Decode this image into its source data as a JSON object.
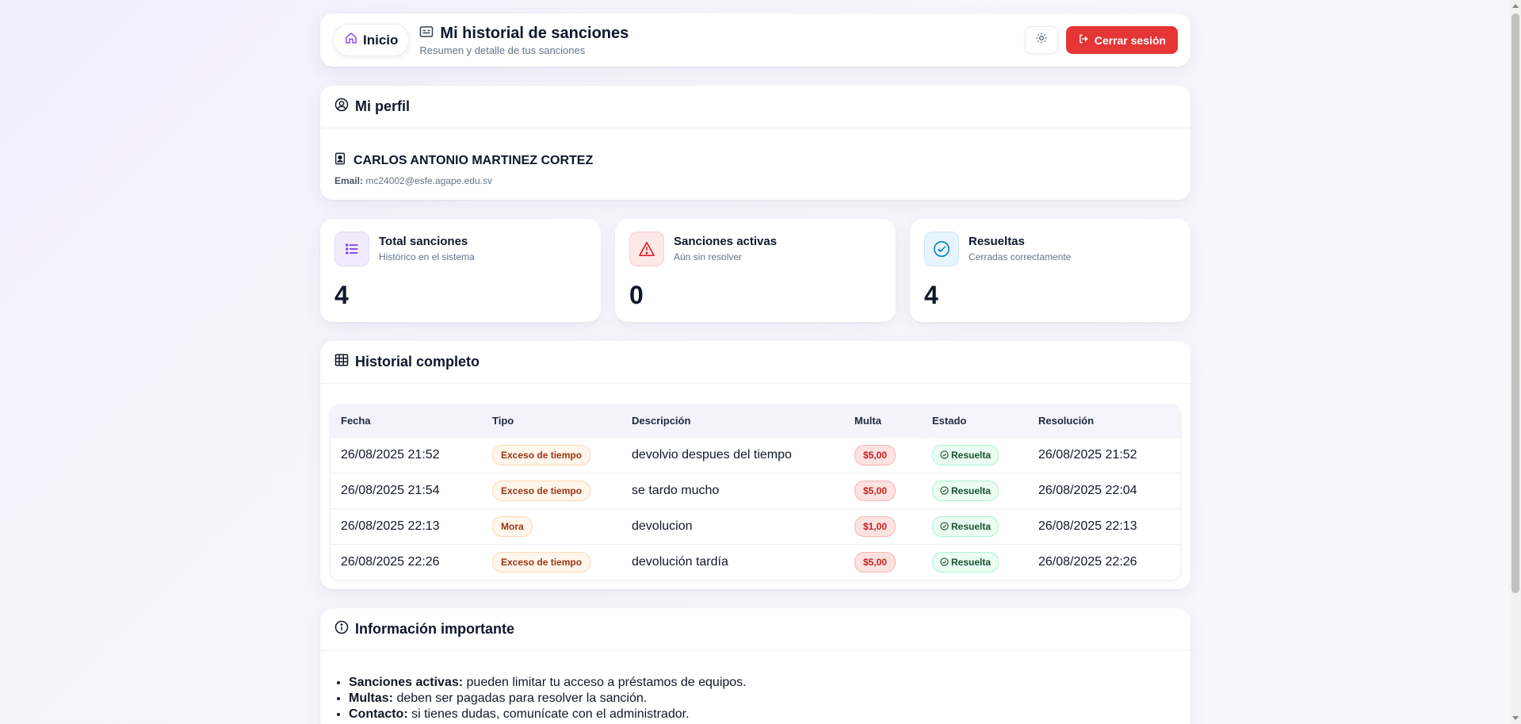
{
  "header": {
    "home_label": "Inicio",
    "title": "Mi historial de sanciones",
    "subtitle": "Resumen y detalle de tus sanciones",
    "logout_label": "Cerrar sesión"
  },
  "profile": {
    "section_title": "Mi perfil",
    "name": "CARLOS ANTONIO MARTINEZ CORTEZ",
    "email_label": "Email:",
    "email": "mc24002@esfe.agape.edu.sv"
  },
  "stats": [
    {
      "title": "Total sanciones",
      "subtitle": "Histórico en el sistema",
      "value": "4",
      "icon": "list-icon",
      "color": "#7c3aed"
    },
    {
      "title": "Sanciones activas",
      "subtitle": "Aún sin resolver",
      "value": "0",
      "icon": "warning-icon",
      "color": "#dc2626"
    },
    {
      "title": "Resueltas",
      "subtitle": "Cerradas correctamente",
      "value": "4",
      "icon": "check-circle-icon",
      "color": "#0284c7"
    }
  ],
  "history": {
    "section_title": "Historial completo",
    "columns": [
      "Fecha",
      "Tipo",
      "Descripción",
      "Multa",
      "Estado",
      "Resolución"
    ],
    "rows": [
      {
        "fecha": "26/08/2025 21:52",
        "tipo": "Exceso de tiempo",
        "descripcion": "devolvio despues del tiempo",
        "multa": "$5,00",
        "estado": "Resuelta",
        "resolucion": "26/08/2025 21:52"
      },
      {
        "fecha": "26/08/2025 21:54",
        "tipo": "Exceso de tiempo",
        "descripcion": "se tardo mucho",
        "multa": "$5,00",
        "estado": "Resuelta",
        "resolucion": "26/08/2025 22:04"
      },
      {
        "fecha": "26/08/2025 22:13",
        "tipo": "Mora",
        "descripcion": "devolucion",
        "multa": "$1,00",
        "estado": "Resuelta",
        "resolucion": "26/08/2025 22:13"
      },
      {
        "fecha": "26/08/2025 22:26",
        "tipo": "Exceso de tiempo",
        "descripcion": "devolución tardía",
        "multa": "$5,00",
        "estado": "Resuelta",
        "resolucion": "26/08/2025 22:26"
      }
    ]
  },
  "info": {
    "section_title": "Información importante",
    "items": [
      {
        "label": "Sanciones activas:",
        "text": " pueden limitar tu acceso a préstamos de equipos."
      },
      {
        "label": "Multas:",
        "text": " deben ser pagadas para resolver la sanción."
      },
      {
        "label": "Contacto:",
        "text": " si tienes dudas, comunícate con el administrador."
      }
    ]
  },
  "colors": {
    "accent": "#7c3aed",
    "danger": "#e53535",
    "success": "#14532d"
  }
}
